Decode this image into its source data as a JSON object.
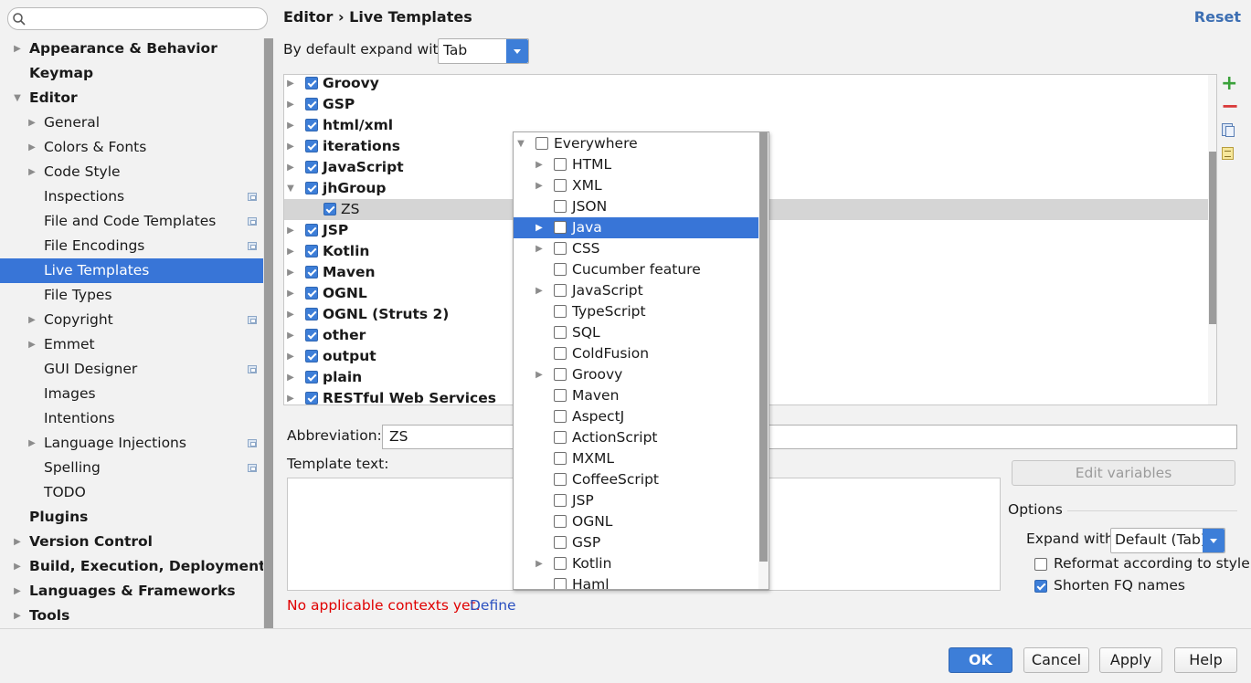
{
  "search": {
    "placeholder": ""
  },
  "sidebar": {
    "items": [
      {
        "label": "Appearance & Behavior",
        "bold": true,
        "level": 0,
        "arrow": "right"
      },
      {
        "label": "Keymap",
        "bold": true,
        "level": 0,
        "arrow": ""
      },
      {
        "label": "Editor",
        "bold": true,
        "level": 0,
        "arrow": "down"
      },
      {
        "label": "General",
        "bold": false,
        "level": 1,
        "arrow": "right"
      },
      {
        "label": "Colors & Fonts",
        "bold": false,
        "level": 1,
        "arrow": "right"
      },
      {
        "label": "Code Style",
        "bold": false,
        "level": 1,
        "arrow": "right"
      },
      {
        "label": "Inspections",
        "bold": false,
        "level": 1,
        "arrow": "",
        "project_icon": true
      },
      {
        "label": "File and Code Templates",
        "bold": false,
        "level": 1,
        "arrow": "",
        "project_icon": true
      },
      {
        "label": "File Encodings",
        "bold": false,
        "level": 1,
        "arrow": "",
        "project_icon": true
      },
      {
        "label": "Live Templates",
        "bold": false,
        "level": 1,
        "arrow": "",
        "selected": true
      },
      {
        "label": "File Types",
        "bold": false,
        "level": 1,
        "arrow": ""
      },
      {
        "label": "Copyright",
        "bold": false,
        "level": 1,
        "arrow": "right",
        "project_icon": true
      },
      {
        "label": "Emmet",
        "bold": false,
        "level": 1,
        "arrow": "right"
      },
      {
        "label": "GUI Designer",
        "bold": false,
        "level": 1,
        "arrow": "",
        "project_icon": true
      },
      {
        "label": "Images",
        "bold": false,
        "level": 1,
        "arrow": ""
      },
      {
        "label": "Intentions",
        "bold": false,
        "level": 1,
        "arrow": ""
      },
      {
        "label": "Language Injections",
        "bold": false,
        "level": 1,
        "arrow": "right",
        "project_icon": true
      },
      {
        "label": "Spelling",
        "bold": false,
        "level": 1,
        "arrow": "",
        "project_icon": true
      },
      {
        "label": "TODO",
        "bold": false,
        "level": 1,
        "arrow": ""
      },
      {
        "label": "Plugins",
        "bold": true,
        "level": 0,
        "arrow": ""
      },
      {
        "label": "Version Control",
        "bold": true,
        "level": 0,
        "arrow": "right"
      },
      {
        "label": "Build, Execution, Deployment",
        "bold": true,
        "level": 0,
        "arrow": "right"
      },
      {
        "label": "Languages & Frameworks",
        "bold": true,
        "level": 0,
        "arrow": "right"
      },
      {
        "label": "Tools",
        "bold": true,
        "level": 0,
        "arrow": "right"
      }
    ]
  },
  "header": {
    "breadcrumb": "Editor › Live Templates",
    "reset_label": "Reset"
  },
  "expand_default": {
    "label": "By default expand with",
    "value": "Tab"
  },
  "templates": [
    {
      "label": "Groovy",
      "bold": true,
      "level": 0,
      "arrow": "right"
    },
    {
      "label": "GSP",
      "bold": true,
      "level": 0,
      "arrow": "right"
    },
    {
      "label": "html/xml",
      "bold": true,
      "level": 0,
      "arrow": "right"
    },
    {
      "label": "iterations",
      "bold": true,
      "level": 0,
      "arrow": "right"
    },
    {
      "label": "JavaScript",
      "bold": true,
      "level": 0,
      "arrow": "right"
    },
    {
      "label": "jhGroup",
      "bold": true,
      "level": 0,
      "arrow": "down"
    },
    {
      "label": "ZS",
      "bold": false,
      "level": 1,
      "arrow": "",
      "selected": true
    },
    {
      "label": "JSP",
      "bold": true,
      "level": 0,
      "arrow": "right"
    },
    {
      "label": "Kotlin",
      "bold": true,
      "level": 0,
      "arrow": "right"
    },
    {
      "label": "Maven",
      "bold": true,
      "level": 0,
      "arrow": "right"
    },
    {
      "label": "OGNL",
      "bold": true,
      "level": 0,
      "arrow": "right"
    },
    {
      "label": "OGNL (Struts 2)",
      "bold": true,
      "level": 0,
      "arrow": "right"
    },
    {
      "label": "other",
      "bold": true,
      "level": 0,
      "arrow": "right"
    },
    {
      "label": "output",
      "bold": true,
      "level": 0,
      "arrow": "right"
    },
    {
      "label": "plain",
      "bold": true,
      "level": 0,
      "arrow": "right"
    },
    {
      "label": "RESTful Web Services",
      "bold": true,
      "level": 0,
      "arrow": "right"
    }
  ],
  "contexts": [
    {
      "label": "Everywhere",
      "level": 0,
      "arrow": "down"
    },
    {
      "label": "HTML",
      "level": 1,
      "arrow": "right"
    },
    {
      "label": "XML",
      "level": 1,
      "arrow": "right"
    },
    {
      "label": "JSON",
      "level": 1,
      "arrow": ""
    },
    {
      "label": "Java",
      "level": 1,
      "arrow": "right",
      "selected": true
    },
    {
      "label": "CSS",
      "level": 1,
      "arrow": "right"
    },
    {
      "label": "Cucumber feature",
      "level": 1,
      "arrow": ""
    },
    {
      "label": "JavaScript",
      "level": 1,
      "arrow": "right"
    },
    {
      "label": "TypeScript",
      "level": 1,
      "arrow": ""
    },
    {
      "label": "SQL",
      "level": 1,
      "arrow": ""
    },
    {
      "label": "ColdFusion",
      "level": 1,
      "arrow": ""
    },
    {
      "label": "Groovy",
      "level": 1,
      "arrow": "right"
    },
    {
      "label": "Maven",
      "level": 1,
      "arrow": ""
    },
    {
      "label": "AspectJ",
      "level": 1,
      "arrow": ""
    },
    {
      "label": "ActionScript",
      "level": 1,
      "arrow": ""
    },
    {
      "label": "MXML",
      "level": 1,
      "arrow": ""
    },
    {
      "label": "CoffeeScript",
      "level": 1,
      "arrow": ""
    },
    {
      "label": "JSP",
      "level": 1,
      "arrow": ""
    },
    {
      "label": "OGNL",
      "level": 1,
      "arrow": ""
    },
    {
      "label": "GSP",
      "level": 1,
      "arrow": ""
    },
    {
      "label": "Kotlin",
      "level": 1,
      "arrow": "right"
    },
    {
      "label": "Haml",
      "level": 1,
      "arrow": ""
    }
  ],
  "abbreviation": {
    "label": "Abbreviation:",
    "value": "ZS"
  },
  "template_text": {
    "label": "Template text:",
    "value": ""
  },
  "edit_variables_label": "Edit variables",
  "options": {
    "title": "Options",
    "expand_label": "Expand with",
    "expand_value": "Default (Tab)",
    "reformat_label": "Reformat according to style",
    "reformat_checked": false,
    "shorten_label": "Shorten FQ names",
    "shorten_checked": true
  },
  "context_status": {
    "message": "No applicable contexts yet.",
    "link": "Define"
  },
  "buttons": {
    "ok": "OK",
    "cancel": "Cancel",
    "apply": "Apply",
    "help": "Help"
  },
  "colors": {
    "accent": "#3d7ed8",
    "selection": "#3875d7",
    "error": "#e00000",
    "link": "#2a50c0"
  }
}
